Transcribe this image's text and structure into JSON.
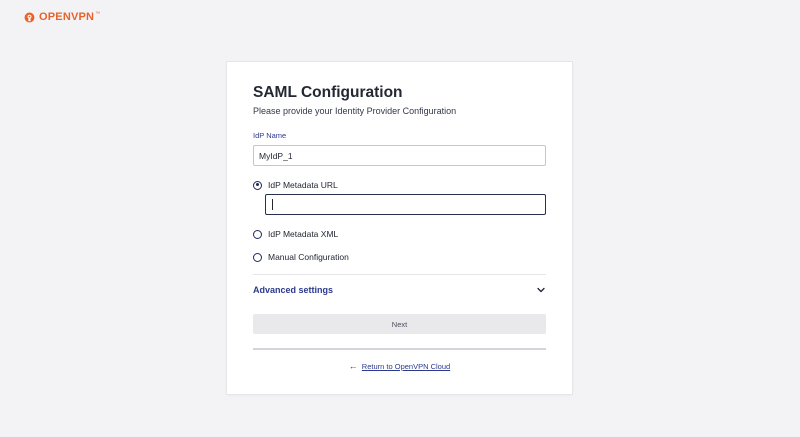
{
  "brand": {
    "name": "OPENVPN",
    "trademark": "™",
    "color": "#e8632b",
    "icon": "openvpn-logo-icon"
  },
  "form": {
    "title": "SAML Configuration",
    "subtitle": "Please provide your Identity Provider Configuration",
    "idp_name": {
      "label": "IdP Name",
      "value": "MyIdP_1"
    },
    "options": [
      {
        "label": "IdP Metadata URL",
        "selected": true
      },
      {
        "label": "IdP Metadata XML",
        "selected": false
      },
      {
        "label": "Manual Configuration",
        "selected": false
      }
    ],
    "metadata_url": {
      "value": ""
    },
    "advanced": {
      "label": "Advanced settings",
      "icon": "chevron-down-icon"
    },
    "next_label": "Next",
    "return": {
      "arrow_icon": "arrow-left-icon",
      "arrow": "←",
      "label": "Return to OpenVPN Cloud"
    }
  },
  "colors": {
    "accent": "#2b3a8c",
    "background": "#f3f3f5",
    "button_disabled": "#e9e9eb"
  }
}
